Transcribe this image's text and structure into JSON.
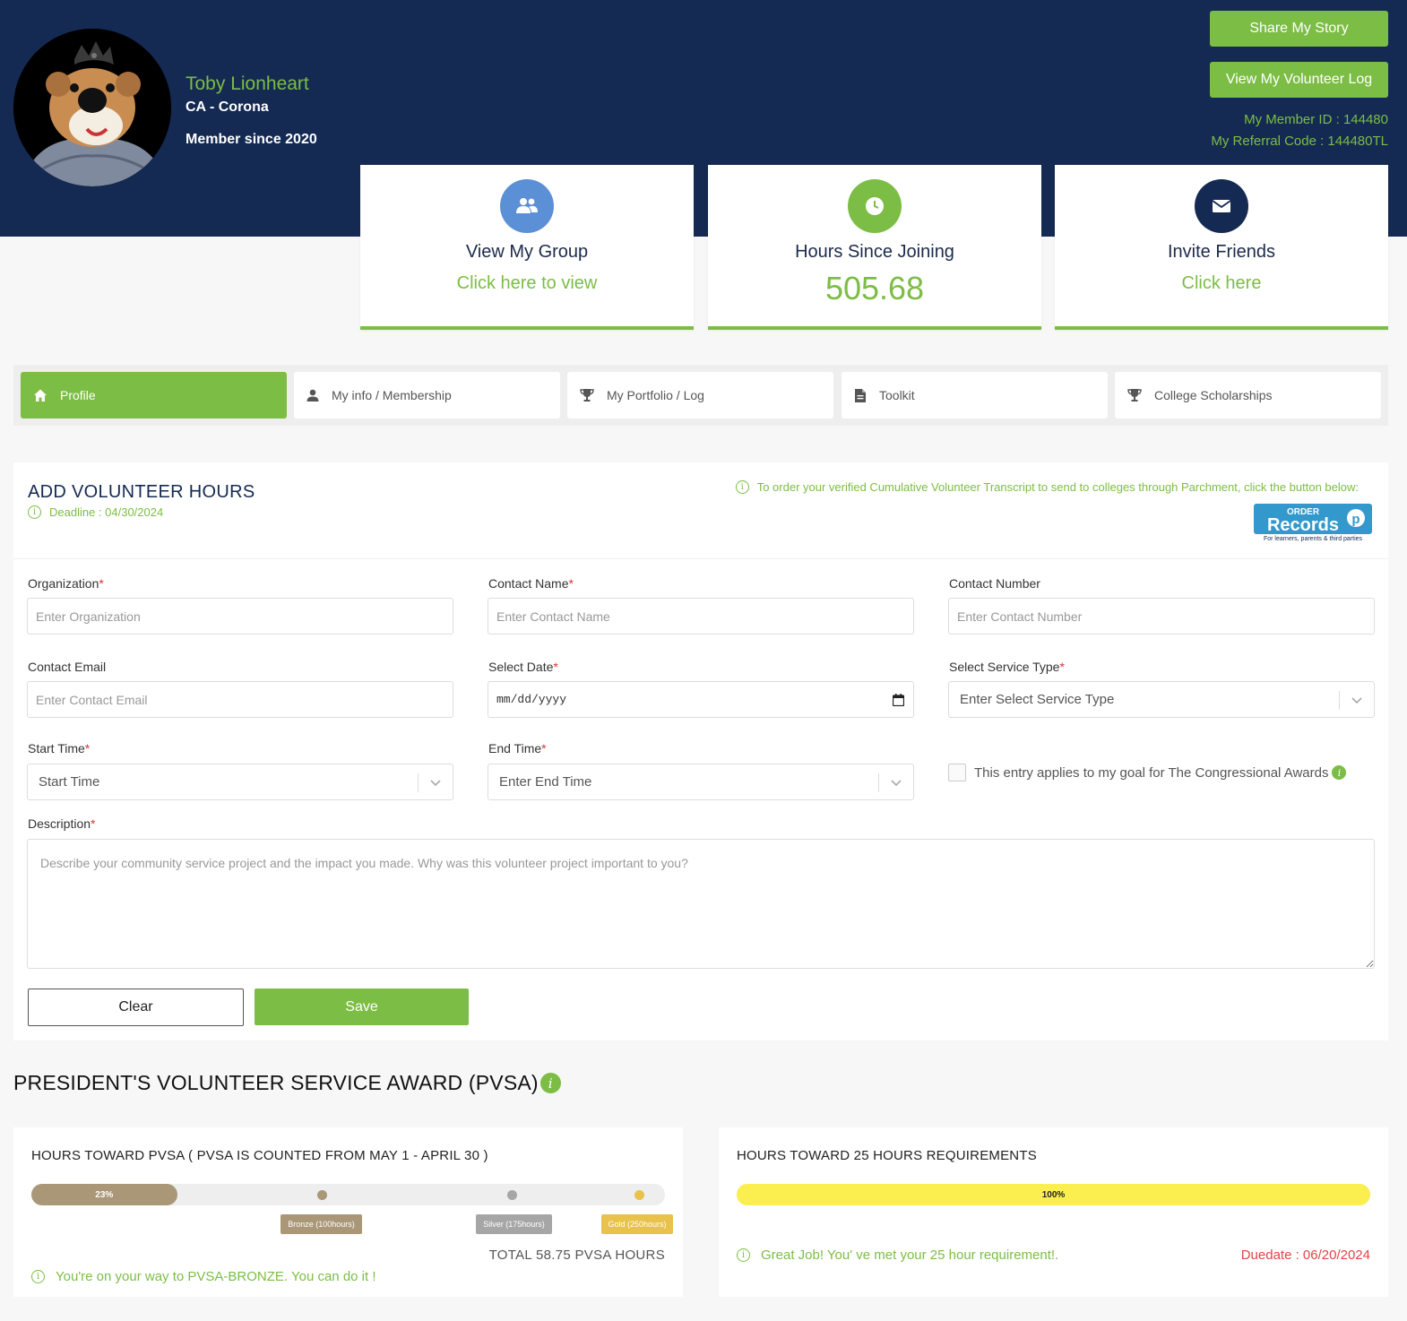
{
  "profile": {
    "name": "Toby Lionheart",
    "location": "CA - Corona",
    "member_since": "Member since 2020",
    "share_label": "Share My Story",
    "log_label": "View My Volunteer Log",
    "member_id": "My Member ID : 144480",
    "referral_code": "My Referral Code : 144480TL"
  },
  "cards": [
    {
      "title": "View My Group",
      "link": "Click here to view",
      "icon": "group-icon",
      "color": "#5b8fd6"
    },
    {
      "title": "Hours Since Joining",
      "value": "505.68",
      "icon": "clock-icon",
      "color": "#7cbd45"
    },
    {
      "title": "Invite Friends",
      "link": "Click here",
      "icon": "envelope-icon",
      "color": "#142a52"
    }
  ],
  "tabs": [
    {
      "label": "Profile",
      "icon": "home-icon",
      "active": true
    },
    {
      "label": "My info / Membership",
      "icon": "user-icon"
    },
    {
      "label": "My Portfolio / Log",
      "icon": "trophy-icon"
    },
    {
      "label": "Toolkit",
      "icon": "document-icon"
    },
    {
      "label": "College Scholarships",
      "icon": "trophy-icon"
    }
  ],
  "form": {
    "title": "ADD VOLUNTEER HOURS",
    "deadline": "Deadline : 04/30/2024",
    "transcript_note": "To order your verified Cumulative Volunteer Transcript to send to colleges through Parchment, click the button below:",
    "order_logo": {
      "top": "ORDER",
      "main": "Records",
      "sub": "For learners, parents & third parties"
    },
    "fields": {
      "organization": {
        "label": "Organization",
        "placeholder": "Enter Organization"
      },
      "contact_name": {
        "label": "Contact Name",
        "placeholder": "Enter Contact Name"
      },
      "contact_number": {
        "label": "Contact Number",
        "placeholder": "Enter Contact Number"
      },
      "contact_email": {
        "label": "Contact Email",
        "placeholder": "Enter Contact Email"
      },
      "select_date": {
        "label": "Select Date",
        "placeholder": "mm/dd/yyyy"
      },
      "service_type": {
        "label": "Select Service Type",
        "placeholder": "Enter Select Service Type"
      },
      "start_time": {
        "label": "Start Time",
        "placeholder": "Start Time"
      },
      "end_time": {
        "label": "End Time",
        "placeholder": "Enter End Time"
      },
      "description": {
        "label": "Description",
        "placeholder": "Describe your community service project and the impact you made. Why was this volunteer project important to you?"
      }
    },
    "required_mark": "*",
    "congressional_checkbox": "This entry applies to my goal for The Congressional Awards",
    "clear_label": "Clear",
    "save_label": "Save"
  },
  "pvsa": {
    "title": "PRESIDENT'S VOLUNTEER SERVICE AWARD (PVSA)",
    "card1": {
      "title": "HOURS TOWARD PVSA ( PVSA IS COUNTED FROM MAY 1 - APRIL 30 )",
      "progress_label": "23%",
      "progress": 0.23,
      "milestones": [
        {
          "label": "Bronze (100hours)",
          "color": "#a99778"
        },
        {
          "label": "Silver (175hours)",
          "color": "#a6a6a6"
        },
        {
          "label": "Gold (250hours)",
          "color": "#e8c24a"
        }
      ],
      "total": "TOTAL 58.75 PVSA HOURS",
      "note": "You're on your way to PVSA-BRONZE. You can do it !"
    },
    "card2": {
      "title": "HOURS TOWARD 25 HOURS REQUIREMENTS",
      "progress_label": "100%",
      "progress": 1.0,
      "note": "Great Job! You' ve met your 25 hour requirement!.",
      "duedate": "Duedate : 06/20/2024"
    }
  }
}
